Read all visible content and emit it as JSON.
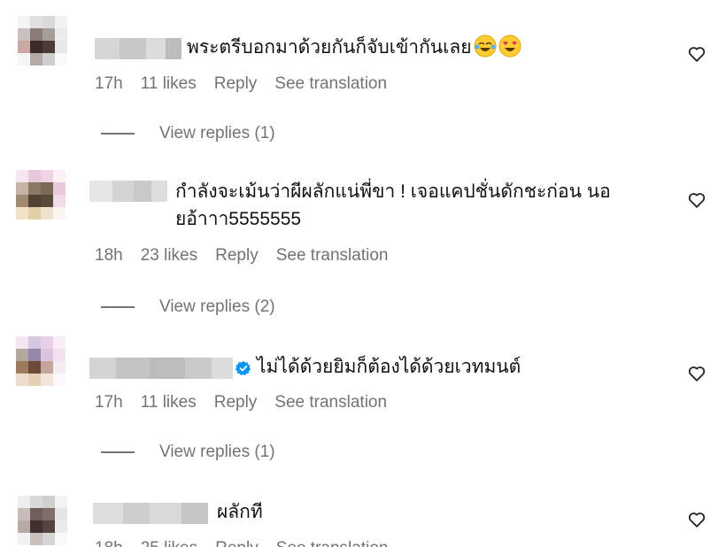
{
  "comments": [
    {
      "text": "พระตรีบอกมาด้วยกันก็จับเข้ากันเลย",
      "emojis": [
        "crying-laughing-emoji",
        "heart-eyes-emoji"
      ],
      "time": "17h",
      "likes": "11 likes",
      "reply": "Reply",
      "translate": "See translation",
      "view_replies": "View replies (1)",
      "verified": false
    },
    {
      "text_line1": "กำลังจะเม้นว่าผีผลักแน่พี่ขา ! เจอแคปชั่นดักชะก่อน นอ",
      "text_line2": "ยอ้าาา5555555",
      "time": "18h",
      "likes": "23 likes",
      "reply": "Reply",
      "translate": "See translation",
      "view_replies": "View replies (2)",
      "verified": false
    },
    {
      "text": "ไม่ได้ด้วยยิมก็ต้องได้ด้วยเวทมนต์",
      "time": "17h",
      "likes": "11 likes",
      "reply": "Reply",
      "translate": "See translation",
      "view_replies": "View replies (1)",
      "verified": true
    },
    {
      "text": "ผลักที",
      "time": "18h",
      "likes": "25 likes",
      "reply": "Reply",
      "translate": "See translation",
      "verified": false
    }
  ],
  "icons": {
    "like": "heart-outline-icon",
    "verified": "verified-badge-icon"
  },
  "colors": {
    "meta_text": "#737373",
    "verified_blue": "#0095f6",
    "text": "#111111"
  }
}
